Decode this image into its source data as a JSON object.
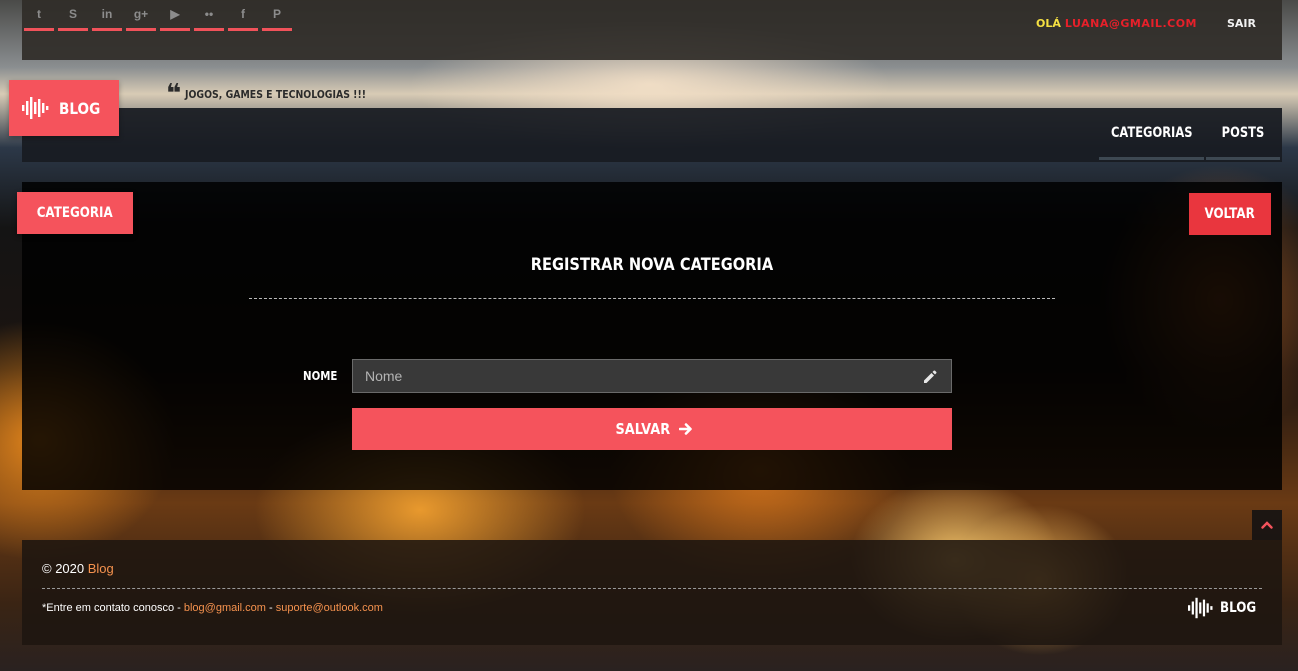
{
  "topbar": {
    "social_icons": [
      "twitter-icon",
      "skype-icon",
      "linkedin-icon",
      "google-plus-icon",
      "youtube-icon",
      "flickr-icon",
      "facebook-icon",
      "pinterest-icon"
    ],
    "social_glyphs": [
      "t",
      "S",
      "in",
      "g+",
      "▶",
      "••",
      "f",
      "P"
    ],
    "greeting": "OLÁ",
    "user_email": "LUANA@GMAIL.COM",
    "logout_label": "SAIR"
  },
  "header": {
    "brand": "BLOG",
    "tagline": "JOGOS, GAMES E TECNOLOGIAS !!!",
    "nav": [
      "CATEGORIAS",
      "POSTS"
    ]
  },
  "panel": {
    "section_label": "CATEGORIA",
    "back_label": "VOLTAR",
    "form_title": "REGISTRAR NOVA CATEGORIA",
    "field_label": "NOME",
    "field_placeholder": "Nome",
    "field_value": "",
    "save_label": "SALVAR"
  },
  "footer": {
    "copyright_prefix": "© 2020",
    "copyright_link": "Blog",
    "contact_prefix": "*Entre em contato conosco -",
    "email_1": "blog@gmail.com",
    "separator": "-",
    "email_2": "suporte@outlook.com",
    "brand": "BLOG"
  },
  "colors": {
    "accent": "#f5535c",
    "back_button": "#e9363e",
    "greeting": "#f5e042",
    "email": "#e7202a",
    "link": "#f5924e"
  }
}
